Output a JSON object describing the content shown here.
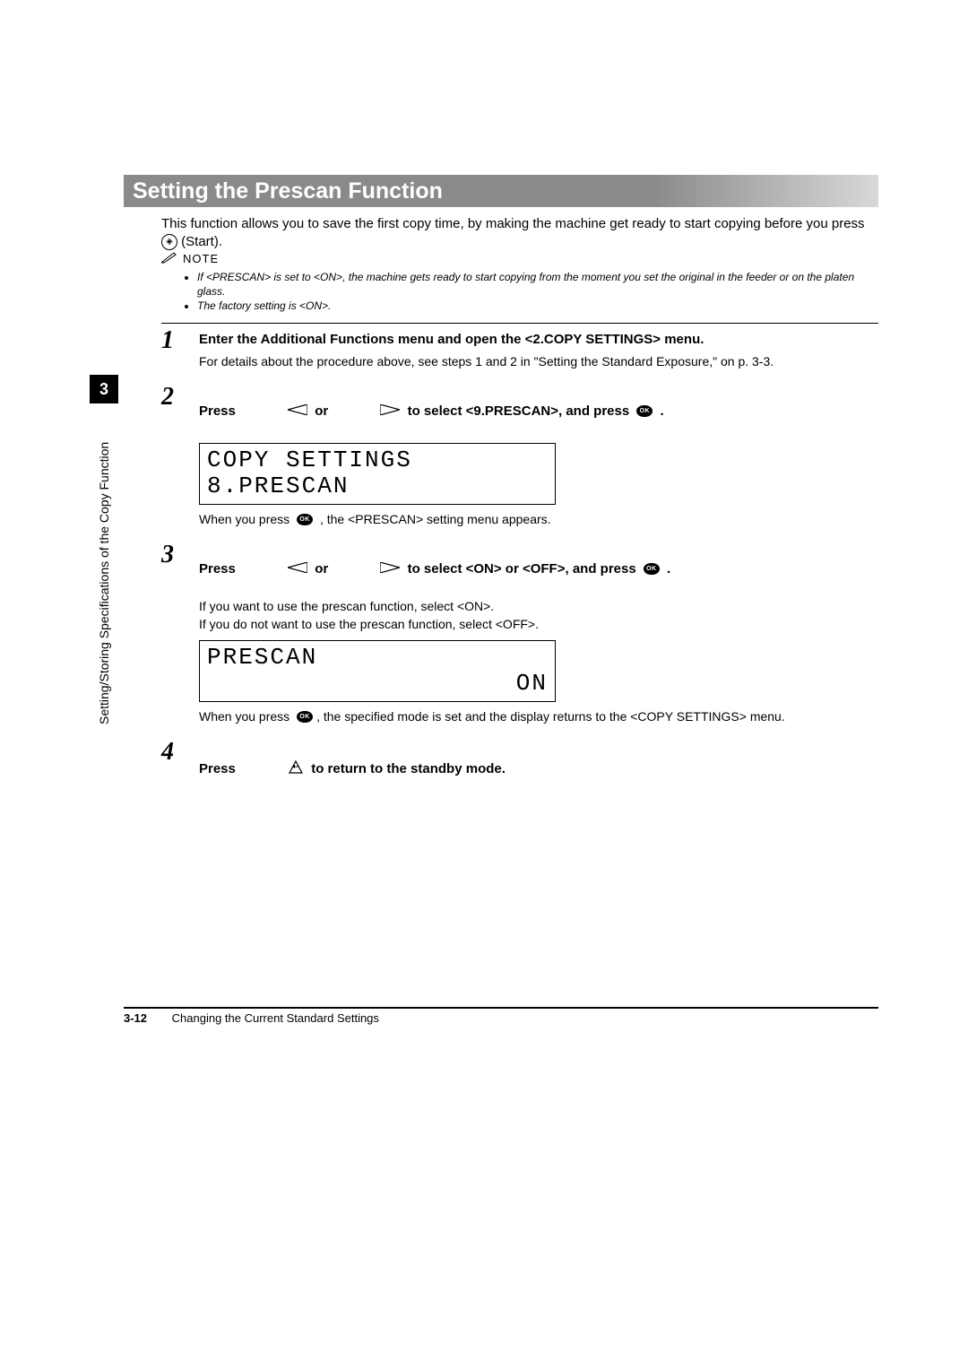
{
  "section_tab": "3",
  "side_label": "Setting/Storing Specifications of the Copy Function",
  "title": "Setting the Prescan Function",
  "intro": {
    "pre": "This function allows you to save the first copy time, by making the machine get ready to start copying before you press ",
    "start_glyph": "◈",
    "post": " (Start)."
  },
  "note": {
    "label": "NOTE",
    "items": [
      "If <PRESCAN> is set to <ON>, the machine gets ready to start copying from the moment you set the original in the feeder or on the platen glass.",
      "The factory setting is <ON>."
    ]
  },
  "steps": {
    "s1": {
      "num": "1",
      "title": "Enter the Additional Functions menu and open the <2.COPY SETTINGS> menu.",
      "desc": "For details about the procedure above, see steps 1 and 2 in \"Setting the Standard Exposure,\" on p. 3-3."
    },
    "s2": {
      "num": "2",
      "t_a": "Press ",
      "t_b": " or ",
      "t_c": " to select <9.PRESCAN>, and press ",
      "t_d": " .",
      "ok_label": "OK",
      "lcd_line1": "COPY SETTINGS",
      "lcd_line2": "8.PRESCAN",
      "after_a": "When you press ",
      "after_b": " , the <PRESCAN> setting menu appears."
    },
    "s3": {
      "num": "3",
      "t_a": "Press ",
      "t_b": " or ",
      "t_c": " to select <ON> or <OFF>, and press ",
      "t_d": " .",
      "ok_label": "OK",
      "desc1": "If you want to use the prescan function, select <ON>.",
      "desc2": "If you do not want to use the prescan function, select <OFF>.",
      "lcd_line1": "PRESCAN",
      "lcd_line2_right": "ON",
      "after_a": "When you press ",
      "after_b": " , the specified mode is set and the display returns to the <COPY SETTINGS> menu."
    },
    "s4": {
      "num": "4",
      "t_a": "Press ",
      "t_b": " to return to the standby mode."
    }
  },
  "footer": {
    "page": "3-12",
    "text": "Changing the Current Standard Settings"
  }
}
